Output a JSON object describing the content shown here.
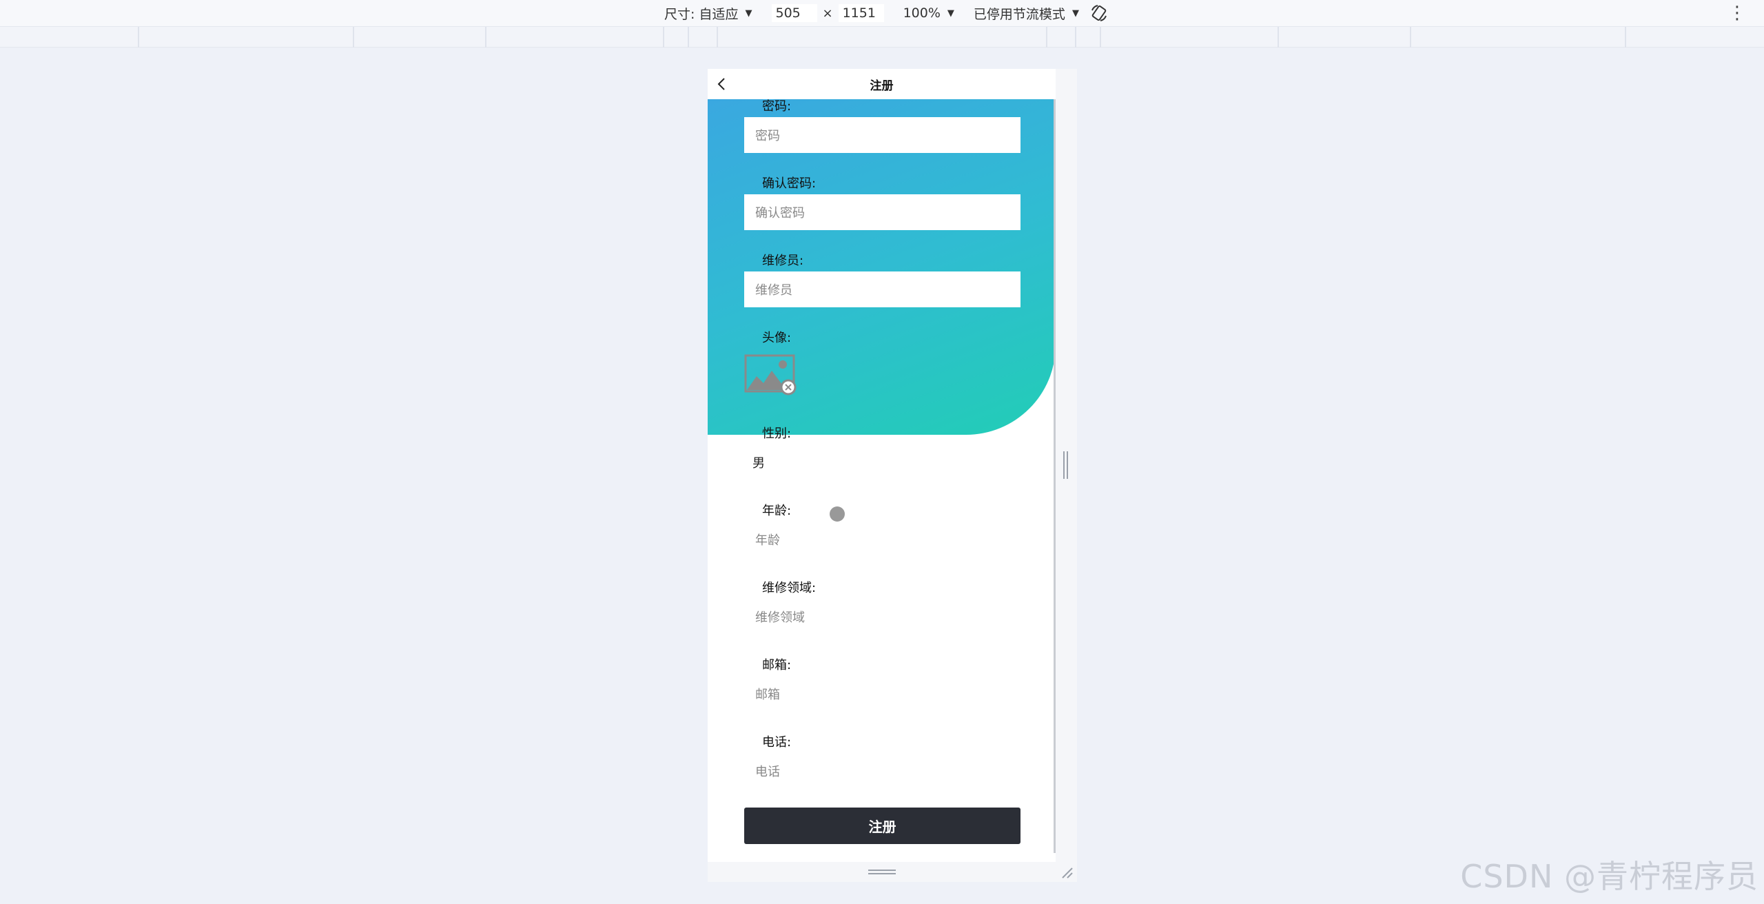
{
  "devtools": {
    "size_label": "尺寸: 自适应",
    "width_value": "505",
    "times": "×",
    "height_value": "1151",
    "zoom": "100%",
    "throttle": "已停用节流模式",
    "more_icon": "more-vertical-icon",
    "rotate_icon": "rotate-icon"
  },
  "page": {
    "title": "注册",
    "back_icon": "chevron-left-icon"
  },
  "form": {
    "password": {
      "label": "密码:",
      "placeholder": "密码"
    },
    "confirm_password": {
      "label": "确认密码:",
      "placeholder": "确认密码"
    },
    "repairman": {
      "label": "维修员:",
      "placeholder": "维修员"
    },
    "avatar": {
      "label": "头像:",
      "icon": "image-placeholder-icon"
    },
    "gender": {
      "label": "性别:",
      "value": "男"
    },
    "age": {
      "label": "年龄:",
      "placeholder": "年龄"
    },
    "repair_field": {
      "label": "维修领域:",
      "placeholder": "维修领域"
    },
    "email": {
      "label": "邮箱:",
      "placeholder": "邮箱"
    },
    "phone": {
      "label": "电话:",
      "placeholder": "电话"
    },
    "submit_label": "注册"
  },
  "colors": {
    "gradient_start": "#3aa8e0",
    "gradient_end": "#22cdb6",
    "submit_bg": "#2b2e36"
  },
  "watermark": "CSDN @青柠程序员"
}
